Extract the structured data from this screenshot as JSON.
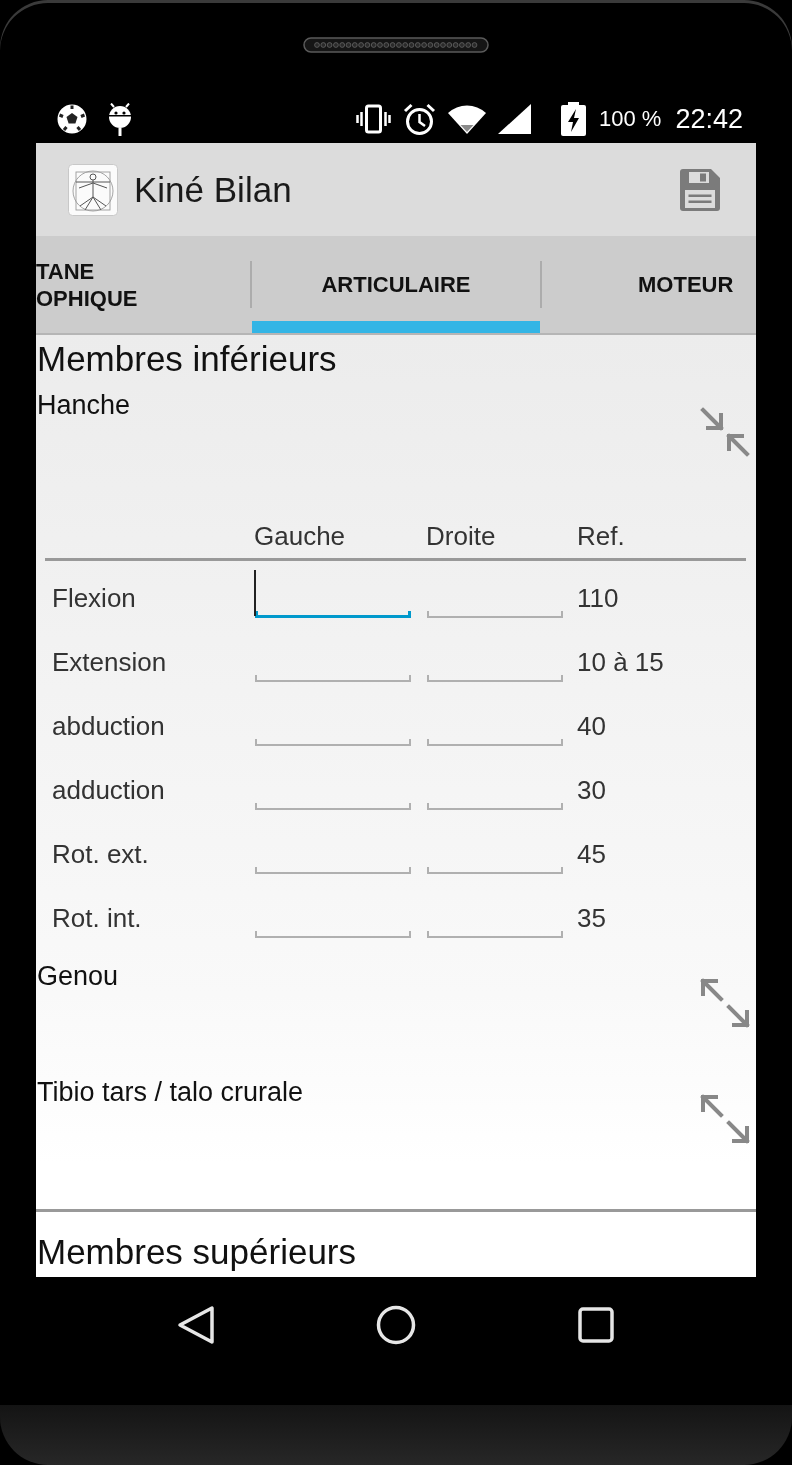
{
  "status_bar": {
    "battery_text": "100 %",
    "time": "22:42"
  },
  "app_bar": {
    "title": "Kiné Bilan"
  },
  "tabs": [
    {
      "label": "TANE OPHIQUE",
      "selected": false
    },
    {
      "label": "ARTICULAIRE",
      "selected": true
    },
    {
      "label": "MOTEUR",
      "selected": false
    }
  ],
  "content": {
    "sections": [
      {
        "title": "Membres inférieurs",
        "joints": [
          {
            "name": "Hanche",
            "expanded": true,
            "table": {
              "columns": [
                "Gauche",
                "Droite",
                "Ref."
              ],
              "rows": [
                {
                  "label": "Flexion",
                  "fields": [
                    {
                      "focused": true
                    },
                    {
                      "focused": false
                    }
                  ],
                  "ref": "110"
                },
                {
                  "label": "Extension",
                  "fields": [
                    {
                      "focused": false
                    },
                    {
                      "focused": false
                    }
                  ],
                  "ref": "10 à 15"
                },
                {
                  "label": "abduction",
                  "fields": [
                    {
                      "focused": false
                    },
                    {
                      "focused": false
                    }
                  ],
                  "ref": "40"
                },
                {
                  "label": "adduction",
                  "fields": [
                    {
                      "focused": false
                    },
                    {
                      "focused": false
                    }
                  ],
                  "ref": "30"
                },
                {
                  "label": "Rot. ext.",
                  "fields": [
                    {
                      "focused": false
                    },
                    {
                      "focused": false
                    }
                  ],
                  "ref": "45"
                },
                {
                  "label": "Rot. int.",
                  "fields": [
                    {
                      "focused": false
                    },
                    {
                      "focused": false
                    }
                  ],
                  "ref": "35"
                }
              ]
            }
          },
          {
            "name": "Genou",
            "expanded": false
          },
          {
            "name": "Tibio tars / talo crurale",
            "expanded": false
          }
        ]
      },
      {
        "title": "Membres supérieurs"
      }
    ]
  }
}
